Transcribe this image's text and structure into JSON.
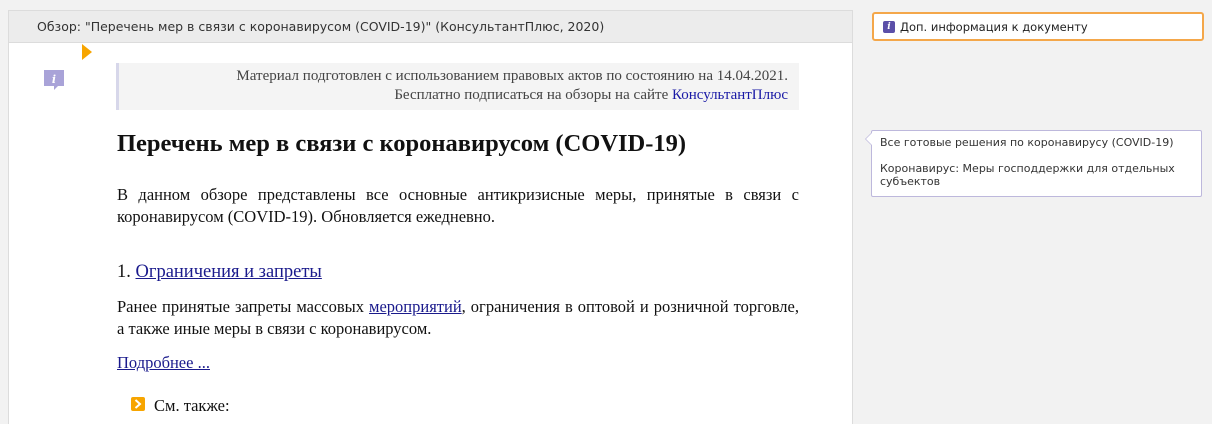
{
  "document": {
    "header_title": "Обзор: \"Перечень мер в связи с коронавирусом (COVID-19)\" (КонсультантПлюс, 2020)",
    "notice": {
      "line1": "Материал подготовлен с использованием правовых актов по состоянию на 14.04.2021.",
      "line2_prefix": "Бесплатно подписаться на обзоры на сайте ",
      "line2_link": "КонсультантПлюс"
    },
    "title": "Перечень мер в связи с коронавирусом (COVID-19)",
    "lead": "В данном обзоре представлены все основные антикризисные меры, принятые в связи с коронавирусом (COVID-19). Обновляется ежедневно.",
    "section": {
      "number": "1. ",
      "title_link": "Ограничения и запреты",
      "desc_before": "Ранее принятые запреты массовых ",
      "desc_link": "мероприятий",
      "desc_after": ", ограничения в оптовой и розничной торговле, а также иные меры в связи с коронавирусом.",
      "more_link": "Подробнее ..."
    },
    "see_also": "См. также:"
  },
  "sidebar": {
    "info_button_label": "Доп. информация к документу",
    "tip_items": [
      "Все готовые решения по коронавирусу (COVID-19)",
      "Коронавирус: Меры господдержки для отдельных субъектов"
    ]
  },
  "icons": {
    "info": "info-icon",
    "bookmark": "bookmark-marker",
    "see_also": "chevron-right-icon"
  },
  "colors": {
    "accent": "#f7a500",
    "link": "#1a1a8c",
    "info_purple": "#5b4fa8"
  }
}
